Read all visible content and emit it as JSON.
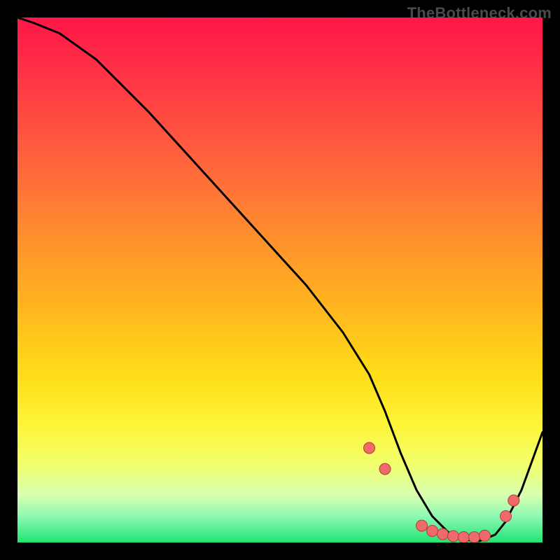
{
  "watermark": "TheBottleneck.com",
  "chart_data": {
    "type": "line",
    "title": "",
    "xlabel": "",
    "ylabel": "",
    "xlim": [
      0,
      100
    ],
    "ylim": [
      0,
      100
    ],
    "x": [
      0,
      3,
      8,
      15,
      25,
      35,
      45,
      55,
      62,
      67,
      70,
      73,
      76,
      79,
      82,
      85,
      88,
      91,
      93,
      96,
      100
    ],
    "y": [
      100,
      99,
      97,
      92,
      82,
      71,
      60,
      49,
      40,
      32,
      25,
      17,
      10,
      5,
      2,
      0.5,
      0.3,
      1.5,
      4,
      10,
      21
    ],
    "markers": {
      "x": [
        67,
        70,
        77,
        79,
        81,
        83,
        85,
        87,
        89,
        93,
        94.5
      ],
      "y": [
        18,
        14,
        3.2,
        2.2,
        1.6,
        1.2,
        1.0,
        1.0,
        1.3,
        5,
        8
      ]
    },
    "gradient_stops": [
      {
        "pos": 0.0,
        "color": "#ff1648"
      },
      {
        "pos": 0.25,
        "color": "#ff5c3e"
      },
      {
        "pos": 0.55,
        "color": "#ffb51f"
      },
      {
        "pos": 0.78,
        "color": "#fdf53a"
      },
      {
        "pos": 0.95,
        "color": "#8ef9b4"
      },
      {
        "pos": 1.0,
        "color": "#22e371"
      }
    ]
  }
}
